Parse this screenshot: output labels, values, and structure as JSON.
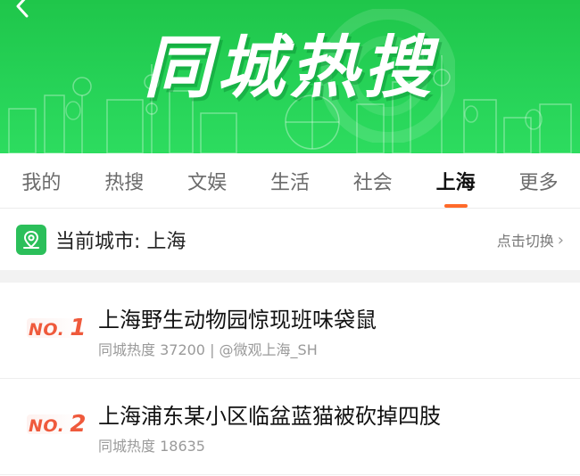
{
  "banner": {
    "title": "同城热搜",
    "bg_color": "#26d257",
    "back_icon": "chevron-left-icon"
  },
  "tabs": [
    {
      "label": "我的",
      "active": false
    },
    {
      "label": "热搜",
      "active": false
    },
    {
      "label": "文娱",
      "active": false
    },
    {
      "label": "生活",
      "active": false
    },
    {
      "label": "社会",
      "active": false
    },
    {
      "label": "上海",
      "active": true
    },
    {
      "label": "更多",
      "active": false
    }
  ],
  "city_bar": {
    "icon": "map-location-icon",
    "label": "当前城市: 上海",
    "switch_label": "点击切换",
    "switch_icon": "chevron-right-icon"
  },
  "list": [
    {
      "rank_prefix": "NO.",
      "rank": "1",
      "title": "上海野生动物园惊现班味袋鼠",
      "meta": "同城热度 37200 | @微观上海_SH"
    },
    {
      "rank_prefix": "NO.",
      "rank": "2",
      "title": "上海浦东某小区临盆蓝猫被砍掉四肢",
      "meta": "同城热度 18635"
    }
  ],
  "colors": {
    "accent": "#ff6a2a",
    "rank": "#ef5a3c",
    "green": "#2bbf5a"
  }
}
